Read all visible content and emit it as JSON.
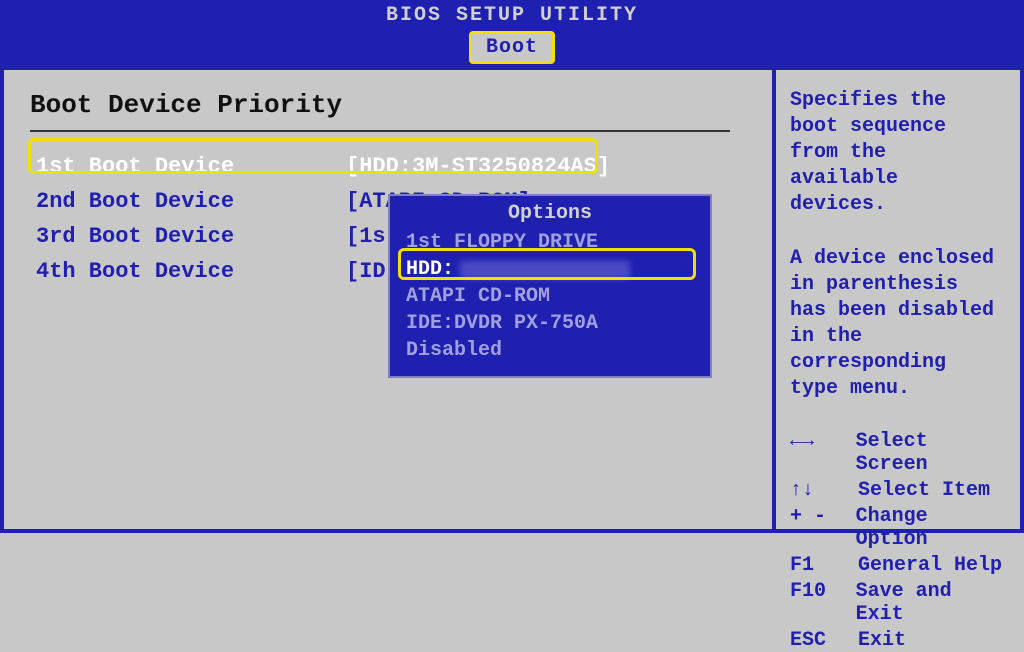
{
  "header": {
    "title": "BIOS SETUP UTILITY"
  },
  "tab": {
    "label": "Boot"
  },
  "section": {
    "title": "Boot Device Priority"
  },
  "boot_rows": [
    {
      "label": "1st Boot Device",
      "value": "[HDD:3M-ST3250824AS]"
    },
    {
      "label": "2nd Boot Device",
      "value": "[ATAPI CD-ROM]"
    },
    {
      "label": "3rd Boot Device",
      "value": "[1s"
    },
    {
      "label": "4th Boot Device",
      "value": "[ID"
    }
  ],
  "options_popup": {
    "title": "Options",
    "items": [
      "1st FLOPPY DRIVE",
      "HDD:",
      "ATAPI CD-ROM",
      "IDE:DVDR PX-750A",
      "Disabled"
    ],
    "selected_index": 1
  },
  "help": {
    "p1": "Specifies the boot sequence from the available devices.",
    "p2": "A device enclosed in parenthesis has been disabled in the corresponding type menu."
  },
  "legend": [
    {
      "key": "←→",
      "action": "Select Screen"
    },
    {
      "key": "↑↓",
      "action": "Select Item"
    },
    {
      "key": "+ -",
      "action": "Change Option"
    },
    {
      "key": "F1",
      "action": "General Help"
    },
    {
      "key": "F10",
      "action": "Save and Exit"
    },
    {
      "key": "ESC",
      "action": "Exit"
    }
  ]
}
